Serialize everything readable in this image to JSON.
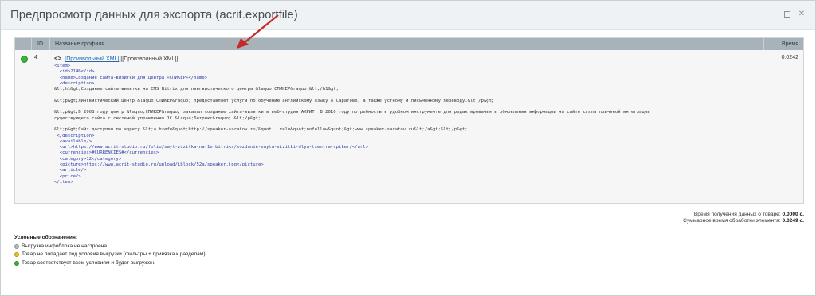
{
  "dialog": {
    "title": "Предпросмотр данных для экспорта (acrit.exportfile)"
  },
  "table": {
    "headers": {
      "id": "ID",
      "name": "Название профиля",
      "time": "Время"
    },
    "row": {
      "id": "4",
      "profile_link": "[Произвольный XML]",
      "profile_text": " [[Произвольный XML]]",
      "time": "0.0242",
      "xml_lines": [
        "<item>",
        "  <id>2140</id>",
        "  <name>Создание сайта-визитки для центра «СПИКЕР»</name>",
        "  <description>",
        "&lt;h1&gt;Создание сайта-визитки на CMS Bitrix для лингвистического центра &laquo;СПИКЕР&raquo;&lt;/h1&gt;",
        "",
        "&lt;p&gt;Лингвистический центр &laquo;СПИКЕР&raquo; предоставляет услуги по обучению английскому языку в Саратове, а также устному и письменному переводу.&lt;/p&gt;",
        "",
        "&lt;p&gt;В 2008 году центр &laquo;СПИКЕР&raquo; заказал создание сайта-визитки в веб-студии АКРИТ. В 2010 году потребность в удобном инструменте для редактирования и обновления информации на сайте стала причиной интеграции",
        "существующего сайта с системой управления 1С &laquo;Битрикс&raquo;.&lt;/p&gt;",
        "",
        "&lt;p&gt;Сайт доступен по адресу &lt;a href=&quot;http://speaker-saratov.ru/&quot;  rel=&quot;nofollow&quot;&gt;www.speaker-saratov.ru&lt;/a&gt;&lt;/p&gt;",
        " </description>",
        "  <available/>",
        "  <url>https://www.acrit-studio.ru/folio/sayt-vizitka-na-1s-bitriks/sozdanie-sayta-vizitki-dlya-tsentra-spiker/</url>",
        "  <currencies>#CURRENCIES#</currencies>",
        "  <category>12</category>",
        "  <picture>https://www.acrit-studio.ru/upload/iblock/52a/speaker.jpg</picture>",
        "  <article/>",
        "  <price/>",
        "</item>"
      ]
    }
  },
  "totals": {
    "line1_label": "Время получения данных о товаре:",
    "line1_value": "0.0000 с.",
    "line2_label": "Суммарное время обработки элемента:",
    "line2_value": "0.0249 с."
  },
  "legend": {
    "title": "Условные обозначения:",
    "items": [
      {
        "text": "Выгрузка инфоблока не настроена.",
        "color": "#b8bcbf"
      },
      {
        "text": "Товар не попадает под условия выгрузки (фильтры + привязка к разделам).",
        "color": "#f0c21b"
      },
      {
        "text": "Товар соответствует всем условиям и будет выгружен.",
        "color": "#3bb33b"
      }
    ]
  },
  "colors": {
    "header_bg": "#a7b3b9",
    "link": "#2067b0",
    "arrow": "#c62828"
  }
}
